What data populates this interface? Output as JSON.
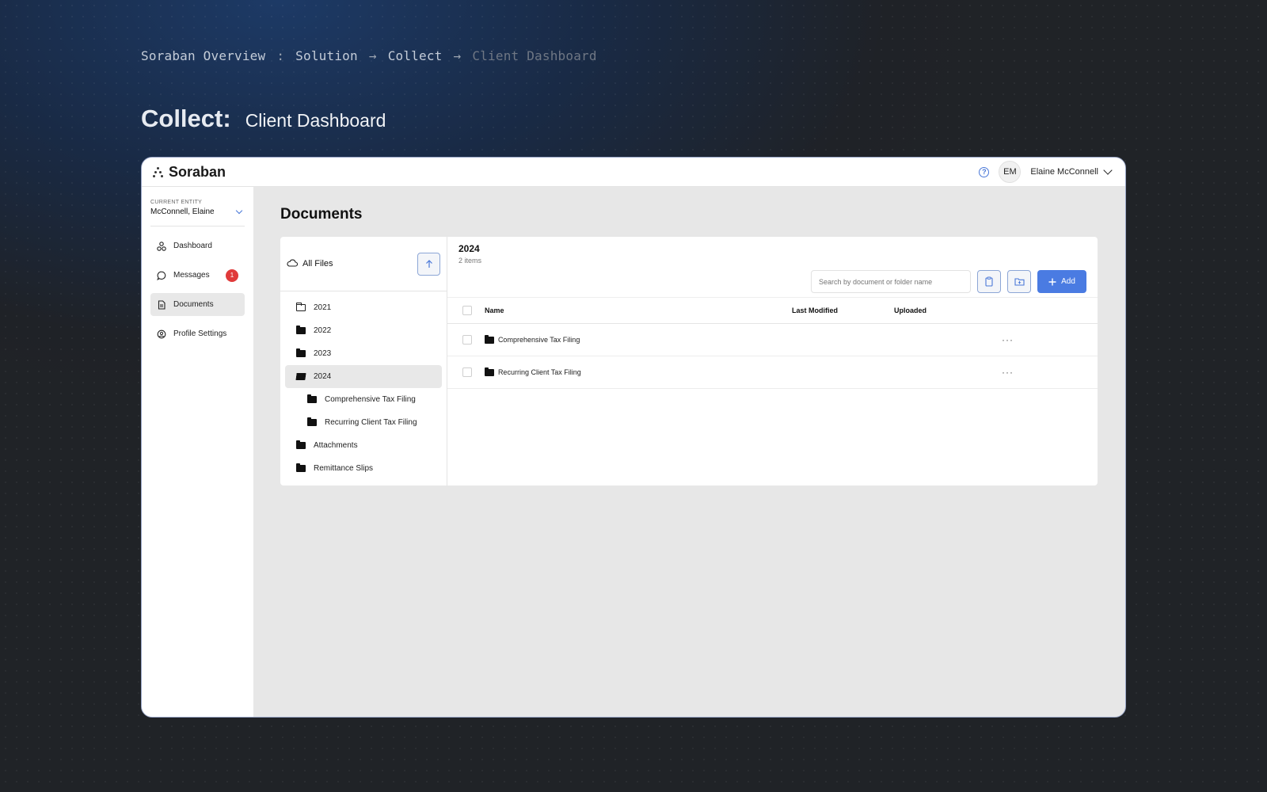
{
  "breadcrumb": {
    "items": [
      "Soraban Overview",
      "Solution",
      "Collect",
      "Client Dashboard"
    ],
    "separators": [
      ":",
      "→",
      "→"
    ]
  },
  "heading": {
    "main": "Collect:",
    "sub": "Client Dashboard"
  },
  "app": {
    "logo": "Soraban",
    "user": {
      "initials": "EM",
      "name": "Elaine McConnell"
    },
    "icons": {
      "help": "help-icon",
      "user_menu": "chevron-down-icon"
    }
  },
  "sidebar": {
    "entity_label": "CURRENT ENTITY",
    "entity_value": "McConnell, Elaine",
    "items": [
      {
        "label": "Dashboard",
        "icon": "dashboard-icon"
      },
      {
        "label": "Messages",
        "icon": "chat-icon",
        "badge": "1"
      },
      {
        "label": "Documents",
        "icon": "document-icon",
        "active": true
      },
      {
        "label": "Profile Settings",
        "icon": "profile-settings-icon"
      }
    ]
  },
  "main": {
    "title": "Documents"
  },
  "tree": {
    "root_label": "All Files",
    "items": [
      "2021",
      "2022",
      "2023",
      "2024",
      "Comprehensive Tax Filing",
      "Recurring Client Tax Filing",
      "Attachments",
      "Remittance Slips"
    ]
  },
  "content": {
    "title": "2024",
    "subtitle": "2 items",
    "search_placeholder": "Search by document or folder name",
    "add_label": "Add",
    "columns": [
      "Name",
      "Last Modified",
      "Uploaded"
    ],
    "rows": [
      {
        "name": "Comprehensive Tax Filing",
        "last_modified": "",
        "uploaded": ""
      },
      {
        "name": "Recurring Client Tax Filing",
        "last_modified": "",
        "uploaded": ""
      }
    ]
  },
  "colors": {
    "accent": "#4a7be2",
    "badge": "#e03a3a",
    "bg_dark": "#202327",
    "bg_blue": "#1d3a66"
  }
}
